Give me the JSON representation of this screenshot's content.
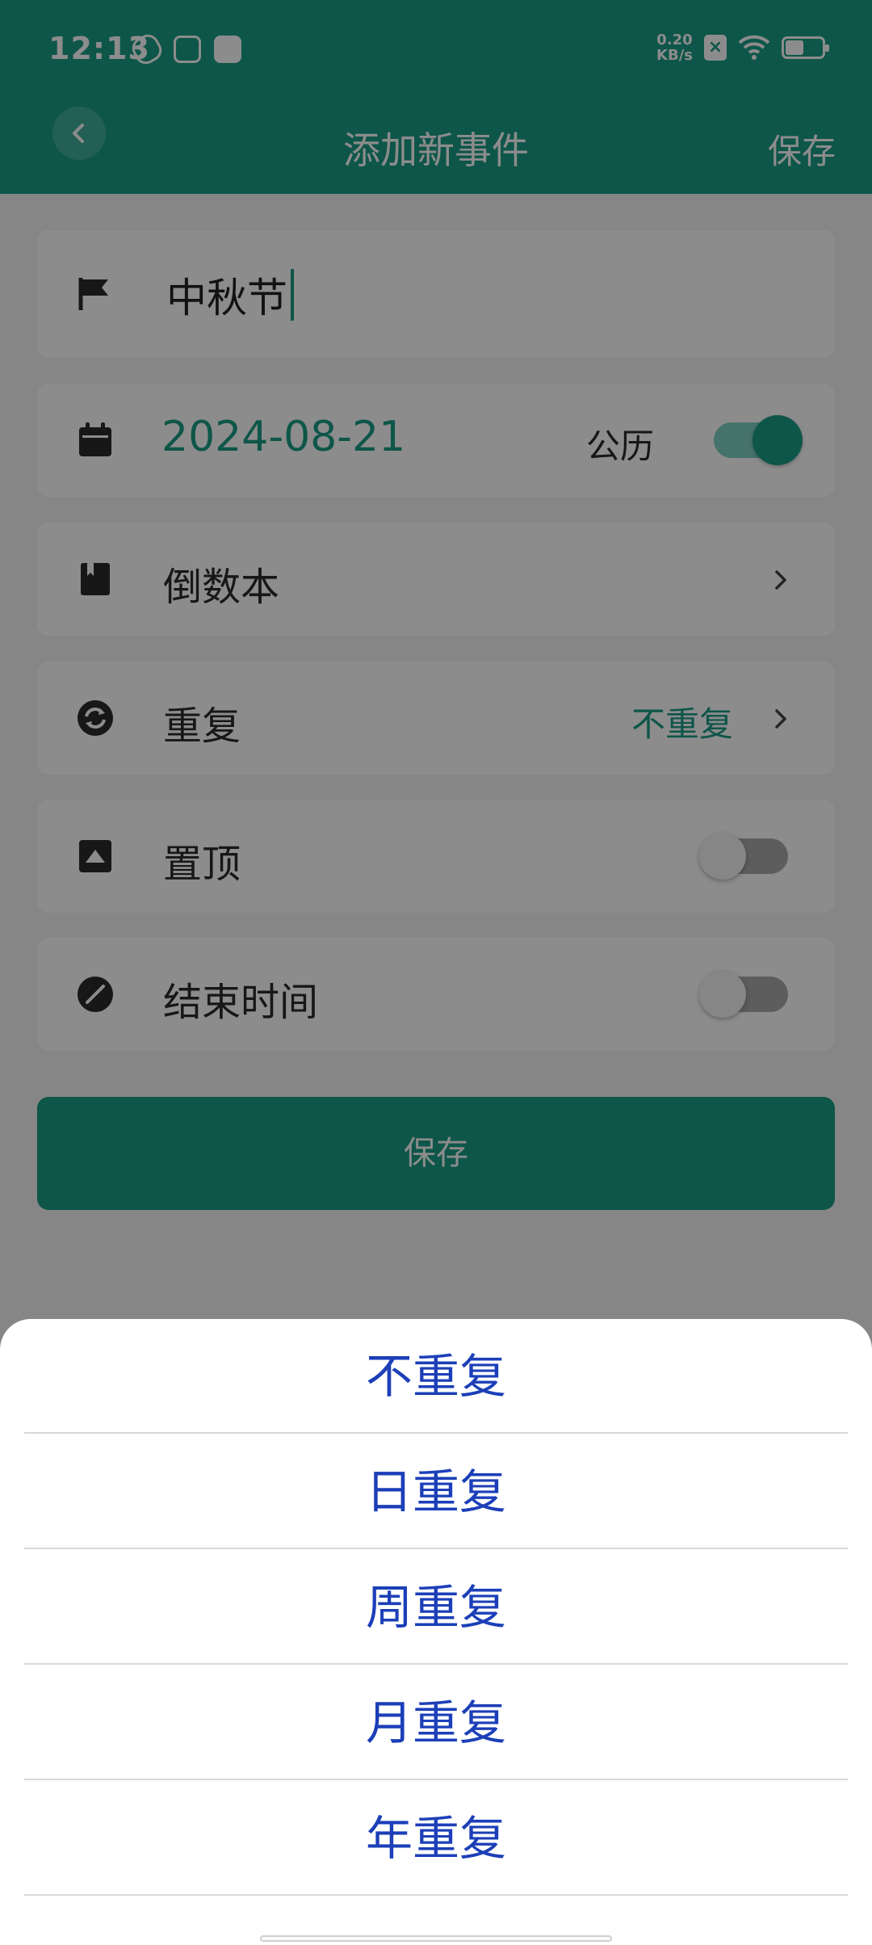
{
  "status_bar": {
    "time": "12:13",
    "net_speed_value": "0.20",
    "net_speed_unit": "KB/s"
  },
  "header": {
    "title": "添加新事件",
    "save_label": "保存"
  },
  "form": {
    "event_name": "中秋节",
    "date_value": "2024-08-21",
    "calendar_type_label": "公历",
    "calendar_toggle_on": true,
    "book_label": "倒数本",
    "repeat_label": "重复",
    "repeat_value": "不重复",
    "pin_label": "置顶",
    "pin_toggle_on": false,
    "end_time_label": "结束时间",
    "end_time_toggle_on": false,
    "save_button_label": "保存"
  },
  "repeat_sheet": {
    "options": [
      "不重复",
      "日重复",
      "周重复",
      "月重复",
      "年重复"
    ]
  },
  "colors": {
    "accent": "#1a9d86",
    "option_text": "#1c3fb8"
  },
  "icons": {
    "back": "chevron-left-icon",
    "name": "flag-icon",
    "date": "calendar-icon",
    "book": "book-icon",
    "repeat": "repeat-icon",
    "pin": "pin-top-icon",
    "end_time": "clock-icon",
    "chevron": "chevron-right-icon"
  }
}
